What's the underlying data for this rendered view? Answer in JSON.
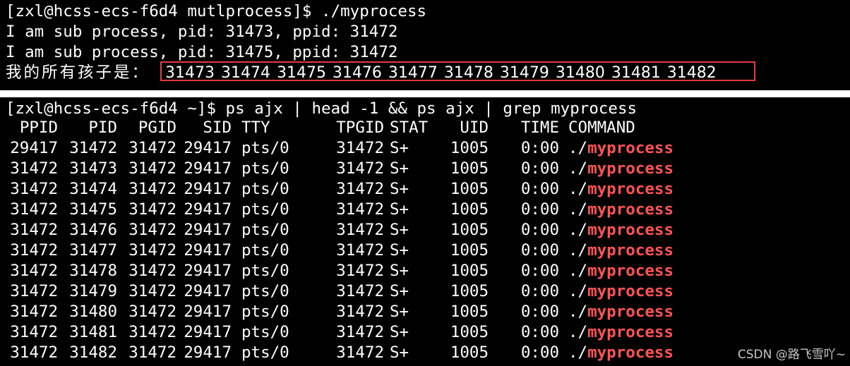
{
  "top_terminal": {
    "prompt_line": "[zxl@hcss-ecs-f6d4 mutlprocess]$ ./myprocess",
    "output_lines": [
      "I am sub process, pid: 31473, ppid: 31472",
      "I am sub process, pid: 31475, ppid: 31472"
    ],
    "children_label": "我的所有孩子是：",
    "children_pids": "31473 31474 31475 31476 31477 31478 31479 31480 31481 31482",
    "highlight_color": "#e8383d"
  },
  "bottom_terminal": {
    "prompt_line": "[zxl@hcss-ecs-f6d4 ~]$ ps ajx | head -1 && ps ajx | grep myprocess",
    "columns": [
      "PPID",
      "PID",
      "PGID",
      "SID",
      "TTY",
      "TPGID",
      "STAT",
      "UID",
      "TIME",
      "COMMAND"
    ],
    "rows": [
      {
        "ppid": "29417",
        "pid": "31472",
        "pgid": "31472",
        "sid": "29417",
        "tty": "pts/0",
        "tpgid": "31472",
        "stat": "S+",
        "uid": "1005",
        "time": "0:00",
        "cmd_prefix": "./",
        "cmd_name": "myprocess"
      },
      {
        "ppid": "31472",
        "pid": "31473",
        "pgid": "31472",
        "sid": "29417",
        "tty": "pts/0",
        "tpgid": "31472",
        "stat": "S+",
        "uid": "1005",
        "time": "0:00",
        "cmd_prefix": "./",
        "cmd_name": "myprocess"
      },
      {
        "ppid": "31472",
        "pid": "31474",
        "pgid": "31472",
        "sid": "29417",
        "tty": "pts/0",
        "tpgid": "31472",
        "stat": "S+",
        "uid": "1005",
        "time": "0:00",
        "cmd_prefix": "./",
        "cmd_name": "myprocess"
      },
      {
        "ppid": "31472",
        "pid": "31475",
        "pgid": "31472",
        "sid": "29417",
        "tty": "pts/0",
        "tpgid": "31472",
        "stat": "S+",
        "uid": "1005",
        "time": "0:00",
        "cmd_prefix": "./",
        "cmd_name": "myprocess"
      },
      {
        "ppid": "31472",
        "pid": "31476",
        "pgid": "31472",
        "sid": "29417",
        "tty": "pts/0",
        "tpgid": "31472",
        "stat": "S+",
        "uid": "1005",
        "time": "0:00",
        "cmd_prefix": "./",
        "cmd_name": "myprocess"
      },
      {
        "ppid": "31472",
        "pid": "31477",
        "pgid": "31472",
        "sid": "29417",
        "tty": "pts/0",
        "tpgid": "31472",
        "stat": "S+",
        "uid": "1005",
        "time": "0:00",
        "cmd_prefix": "./",
        "cmd_name": "myprocess"
      },
      {
        "ppid": "31472",
        "pid": "31478",
        "pgid": "31472",
        "sid": "29417",
        "tty": "pts/0",
        "tpgid": "31472",
        "stat": "S+",
        "uid": "1005",
        "time": "0:00",
        "cmd_prefix": "./",
        "cmd_name": "myprocess"
      },
      {
        "ppid": "31472",
        "pid": "31479",
        "pgid": "31472",
        "sid": "29417",
        "tty": "pts/0",
        "tpgid": "31472",
        "stat": "S+",
        "uid": "1005",
        "time": "0:00",
        "cmd_prefix": "./",
        "cmd_name": "myprocess"
      },
      {
        "ppid": "31472",
        "pid": "31480",
        "pgid": "31472",
        "sid": "29417",
        "tty": "pts/0",
        "tpgid": "31472",
        "stat": "S+",
        "uid": "1005",
        "time": "0:00",
        "cmd_prefix": "./",
        "cmd_name": "myprocess"
      },
      {
        "ppid": "31472",
        "pid": "31481",
        "pgid": "31472",
        "sid": "29417",
        "tty": "pts/0",
        "tpgid": "31472",
        "stat": "S+",
        "uid": "1005",
        "time": "0:00",
        "cmd_prefix": "./",
        "cmd_name": "myprocess"
      },
      {
        "ppid": "31472",
        "pid": "31482",
        "pgid": "31472",
        "sid": "29417",
        "tty": "pts/0",
        "tpgid": "31472",
        "stat": "S+",
        "uid": "1005",
        "time": "0:00",
        "cmd_prefix": "./",
        "cmd_name": "myprocess"
      }
    ],
    "match_color": "#ff5252"
  },
  "watermark": "CSDN @路飞雪吖~"
}
